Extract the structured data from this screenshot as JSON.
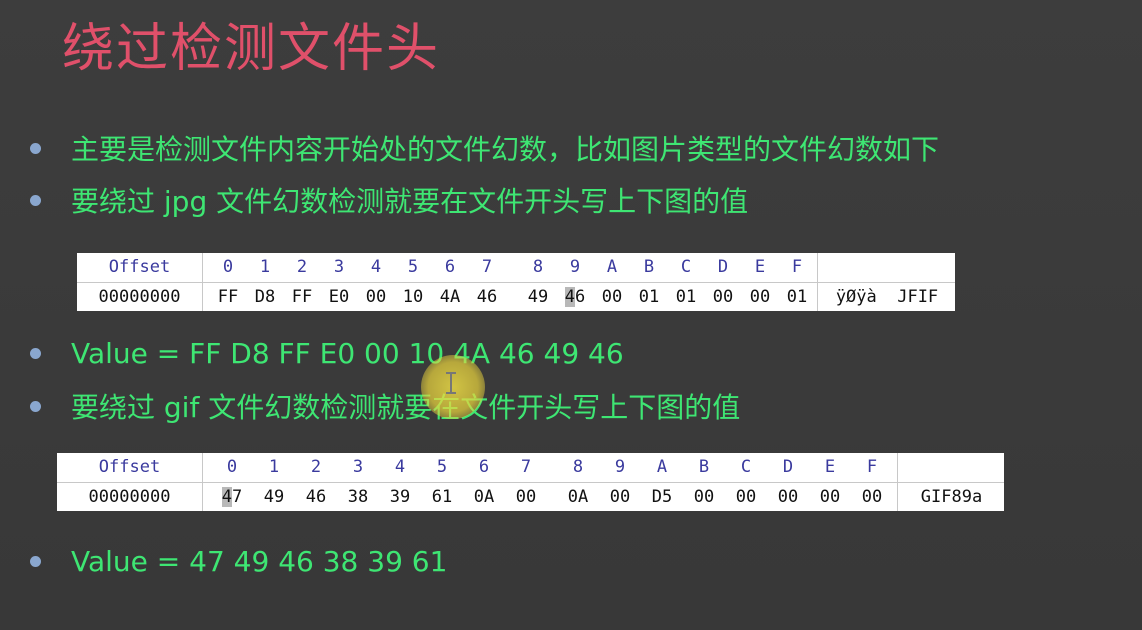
{
  "slide": {
    "title": "绕过检测文件头",
    "bullets": [
      "主要是检测文件内容开始处的文件幻数，比如图片类型的文件幻数如下",
      "要绕过 jpg 文件幻数检测就要在文件开头写上下图的值",
      "Value = FF D8 FF E0 00 10 4A 46 49 46",
      "要绕过 gif 文件幻数检测就要在文件开头写上下图的值",
      "Value = 47 49 46 38 39 61"
    ]
  },
  "hex_headers": [
    "0",
    "1",
    "2",
    "3",
    "4",
    "5",
    "6",
    "7",
    "8",
    "9",
    "A",
    "B",
    "C",
    "D",
    "E",
    "F"
  ],
  "jpg_table": {
    "header_label": "Offset",
    "offset": "00000000",
    "bytes": [
      "FF",
      "D8",
      "FF",
      "E0",
      "00",
      "10",
      "4A",
      "46",
      "49",
      "46",
      "00",
      "01",
      "01",
      "00",
      "00",
      "01"
    ],
    "ascii": "ÿØÿà  JFIF"
  },
  "gif_table": {
    "header_label": "Offset",
    "offset": "00000000",
    "bytes": [
      "47",
      "49",
      "46",
      "38",
      "39",
      "61",
      "0A",
      "00",
      "0A",
      "00",
      "D5",
      "00",
      "00",
      "00",
      "00",
      "00"
    ],
    "ascii": "GIF89a"
  }
}
